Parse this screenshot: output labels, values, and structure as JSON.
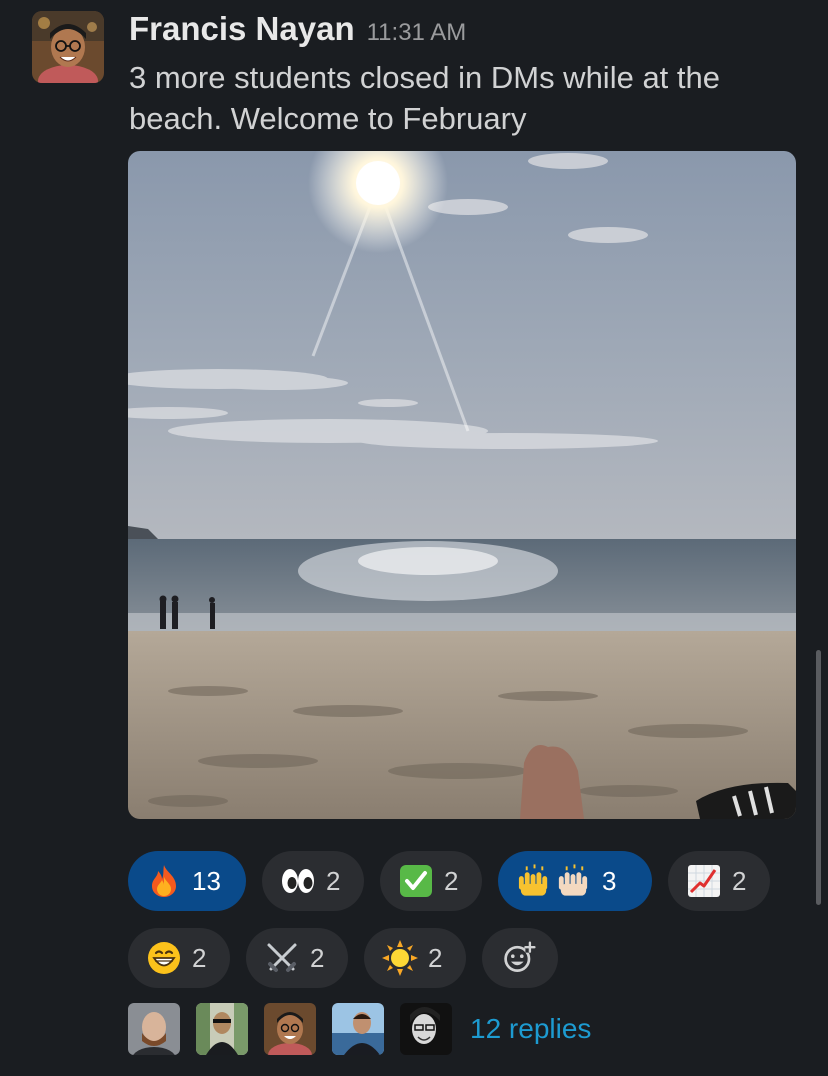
{
  "message": {
    "author": "Francis Nayan",
    "timestamp": "11:31 AM",
    "text": "3 more students closed in DMs while at the beach. Welcome to February",
    "avatar_icon": "person-avatar"
  },
  "attachment": {
    "type": "photo",
    "icon": "beach-photo"
  },
  "reactions": [
    {
      "emoji": "fire",
      "count": "13",
      "active": true
    },
    {
      "emoji": "eyes",
      "count": "2",
      "active": false
    },
    {
      "emoji": "check-mark",
      "count": "2",
      "active": false
    },
    {
      "emoji": "raised-hands",
      "count": "3",
      "active": true
    },
    {
      "emoji": "chart-increasing",
      "count": "2",
      "active": false
    },
    {
      "emoji": "grinning-face",
      "count": "2",
      "active": false
    },
    {
      "emoji": "crossed-swords",
      "count": "2",
      "active": false
    },
    {
      "emoji": "sun",
      "count": "2",
      "active": false
    }
  ],
  "add_reaction_icon": "add-emoji-icon",
  "thread": {
    "replies_label": "12 replies",
    "reply_avatars": [
      "avatar-1",
      "avatar-2",
      "avatar-3",
      "avatar-4",
      "avatar-5"
    ]
  },
  "colors": {
    "background": "#1a1d21",
    "reaction_bg": "#2b2d31",
    "reaction_active_bg": "#0a4a8a",
    "link": "#1d9bd1"
  }
}
